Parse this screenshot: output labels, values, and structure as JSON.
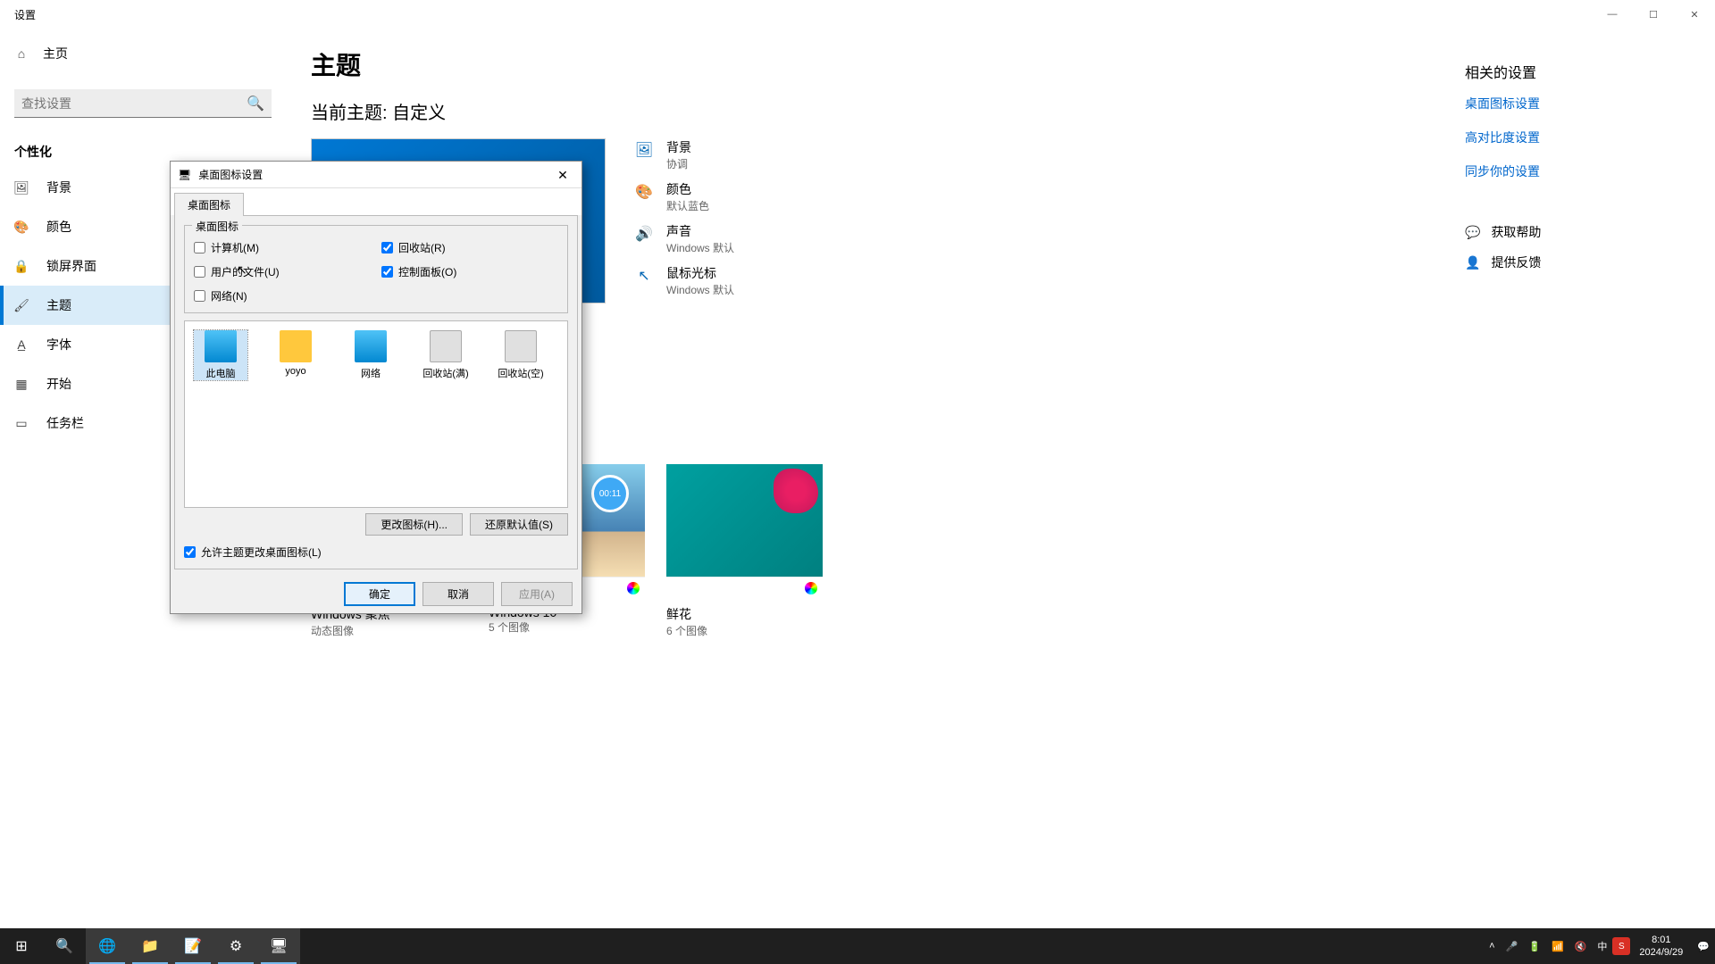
{
  "window": {
    "title": "设置"
  },
  "titlebar_icons": {
    "min": "—",
    "max": "☐",
    "close": "✕"
  },
  "sidebar": {
    "home": "主页",
    "search_placeholder": "查找设置",
    "category": "个性化",
    "items": [
      {
        "label": "背景",
        "icon": "picture"
      },
      {
        "label": "颜色",
        "icon": "palette"
      },
      {
        "label": "锁屏界面",
        "icon": "lock"
      },
      {
        "label": "主题",
        "icon": "brush",
        "active": true
      },
      {
        "label": "字体",
        "icon": "font"
      },
      {
        "label": "开始",
        "icon": "grid"
      },
      {
        "label": "任务栏",
        "icon": "taskbar"
      }
    ]
  },
  "page": {
    "title": "主题",
    "current_theme_label": "当前主题: 自定义",
    "props": [
      {
        "label": "背景",
        "value": "协调"
      },
      {
        "label": "颜色",
        "value": "默认蓝色"
      },
      {
        "label": "声音",
        "value": "Windows 默认"
      },
      {
        "label": "鼠标光标",
        "value": "Windows 默认"
      }
    ],
    "themes": [
      {
        "name": "Windows 聚焦",
        "desc": "动态图像",
        "badge": "spotlight"
      },
      {
        "name": "Windows 10",
        "desc": "5 个图像",
        "badge": "timer",
        "timer": "00:11"
      },
      {
        "name": "鲜花",
        "desc": "6 个图像",
        "badge": "color"
      }
    ]
  },
  "right": {
    "related": "相关的设置",
    "links": [
      "桌面图标设置",
      "高对比度设置",
      "同步你的设置"
    ],
    "help": "获取帮助",
    "feedback": "提供反馈"
  },
  "dialog": {
    "title": "桌面图标设置",
    "tab": "桌面图标",
    "group": "桌面图标",
    "checks": [
      {
        "label": "计算机(M)",
        "checked": false
      },
      {
        "label": "回收站(R)",
        "checked": true
      },
      {
        "label": "用户的文件(U)",
        "checked": false
      },
      {
        "label": "控制面板(O)",
        "checked": true
      },
      {
        "label": "网络(N)",
        "checked": false
      }
    ],
    "icons": [
      {
        "label": "此电脑",
        "type": "folder",
        "selected": true
      },
      {
        "label": "yoyo",
        "type": "user"
      },
      {
        "label": "网络",
        "type": "folder"
      },
      {
        "label": "回收站(满)",
        "type": "bin"
      },
      {
        "label": "回收站(空)",
        "type": "bin"
      }
    ],
    "change_icon": "更改图标(H)...",
    "restore": "还原默认值(S)",
    "allow": "允许主题更改桌面图标(L)",
    "ok": "确定",
    "cancel": "取消",
    "apply": "应用(A)"
  },
  "taskbar": {
    "time": "8:01",
    "date": "2024/9/29",
    "ime": "中"
  }
}
